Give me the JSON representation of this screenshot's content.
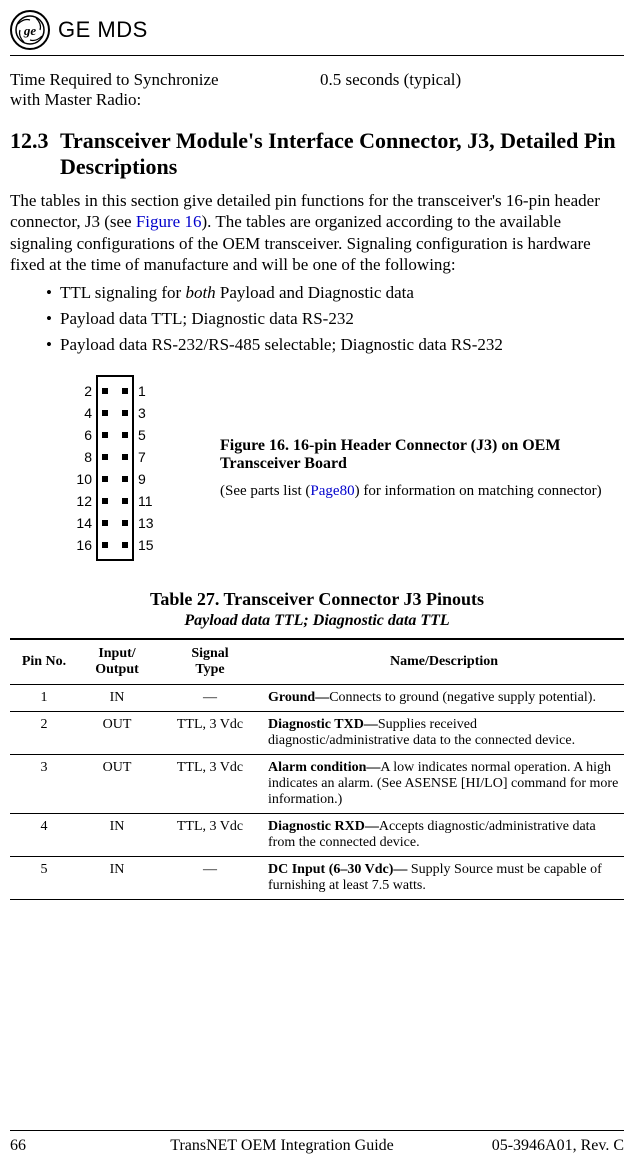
{
  "brand": {
    "ge": "GE",
    "mds": "MDS"
  },
  "spec": {
    "label_line1": "Time Required to Synchronize",
    "label_line2": "with Master Radio:",
    "value": "0.5 seconds (typical)"
  },
  "section": {
    "number": "12.3",
    "title": "Transceiver Module's Interface Connector, J3, Detailed Pin Descriptions"
  },
  "intro": {
    "p1a": "The tables in this section give detailed pin functions for the transceiver's 16-pin header connector, J3 (see ",
    "p1link": "Figure 16",
    "p1b": "). The tables are organized according to the available signaling configurations of the OEM transceiver. Signaling configuration is hardware fixed at the time of manufacture and will be one of the following:"
  },
  "bullets": {
    "b1a": "TTL signaling for ",
    "b1i": "both",
    "b1b": " Payload and Diagnostic data",
    "b2": "Payload data TTL; Diagnostic data RS-232",
    "b3": "Payload data RS-232/RS-485 selectable; Diagnostic data RS-232"
  },
  "connector": {
    "left": [
      "2",
      "4",
      "6",
      "8",
      "10",
      "12",
      "14",
      "16"
    ],
    "right": [
      "1",
      "3",
      "5",
      "7",
      "9",
      "11",
      "13",
      "15"
    ]
  },
  "figure": {
    "title": "Figure 16. 16-pin Header Connector (J3) on OEM Transceiver Board",
    "note_a": "(See parts list (",
    "note_link": "Page80",
    "note_b": ") for information on matching connector)"
  },
  "table": {
    "title": "Table 27. Transceiver Connector J3 Pinouts",
    "subtitle": "Payload data TTL; Diagnostic data TTL",
    "headers": {
      "pin": "Pin No.",
      "io": "Input/\nOutput",
      "sig": "Signal\nType",
      "desc": "Name/Description"
    },
    "rows": [
      {
        "pin": "1",
        "io": "IN",
        "sig": "—",
        "name": "Ground—",
        "desc": "Connects to ground (negative supply potential)."
      },
      {
        "pin": "2",
        "io": "OUT",
        "sig": "TTL, 3 Vdc",
        "name": "Diagnostic TXD—",
        "desc": "Supplies received diagnostic/administrative data to the connected device."
      },
      {
        "pin": "3",
        "io": "OUT",
        "sig": "TTL, 3 Vdc",
        "name": "Alarm condition—",
        "desc": "A low indicates normal operation. A high indicates an alarm. (See ASENSE [HI/LO] command for more information.)"
      },
      {
        "pin": "4",
        "io": "IN",
        "sig": "TTL, 3 Vdc",
        "name": "Diagnostic RXD—",
        "desc": "Accepts diagnostic/administrative data from the connected device."
      },
      {
        "pin": "5",
        "io": "IN",
        "sig": "—",
        "name": "DC Input (6–30 Vdc)— ",
        "desc": "Supply Source must be capable of furnishing at least 7.5 watts."
      }
    ]
  },
  "footer": {
    "page": "66",
    "doc": "TransNET OEM Integration Guide",
    "rev": "05-3946A01, Rev. C"
  }
}
